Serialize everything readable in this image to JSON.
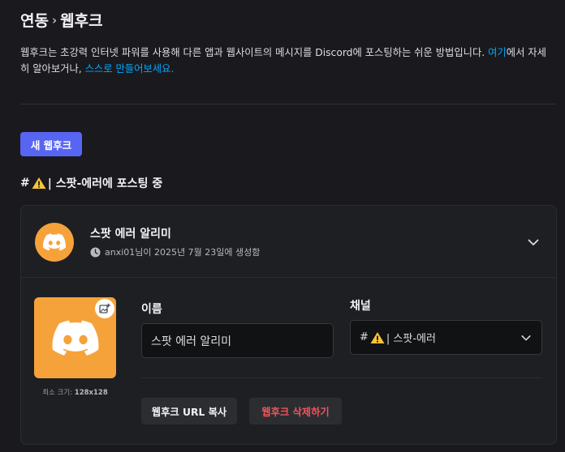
{
  "breadcrumb": {
    "parent": "연동",
    "separator": "›",
    "current": "웹후크"
  },
  "description": {
    "text": "웹후크는 초강력 인터넷 파워를 사용해 다른 앱과 웹사이트의 메시지를 Discord에 포스팅하는 쉬운 방법입니다. ",
    "link1": "여기",
    "middle": "에서 자세히 알아보거나, ",
    "link2": "스스로 만들어보세요."
  },
  "new_webhook_label": "새 웹후크",
  "channel_heading": {
    "hash": "#",
    "rest": " | 스팟-에러에 포스팅 중"
  },
  "webhook": {
    "name": "스팟 에러 알리미",
    "meta": "anxi01님이 2025년 7월 23일에 생성함",
    "name_label": "이름",
    "name_value": "스팟 에러 알리미",
    "channel_label": "채널",
    "channel_hash": "#",
    "channel_rest": " | 스팟-에러",
    "min_size_prefix": "최소 크기: ",
    "min_size_value": "128x128",
    "copy_url_label": "웹후크 URL 복사",
    "delete_label": "웹후크 삭제하기"
  },
  "colors": {
    "accent": "#5865f2",
    "avatar": "#f6a23a",
    "link": "#00a8fc",
    "danger": "#f0555b",
    "background": "#1a1a1e"
  },
  "icons": [
    "chevron-right-icon",
    "warning-icon",
    "discord-logo-icon",
    "clock-icon",
    "chevron-down-icon",
    "add-image-icon"
  ]
}
